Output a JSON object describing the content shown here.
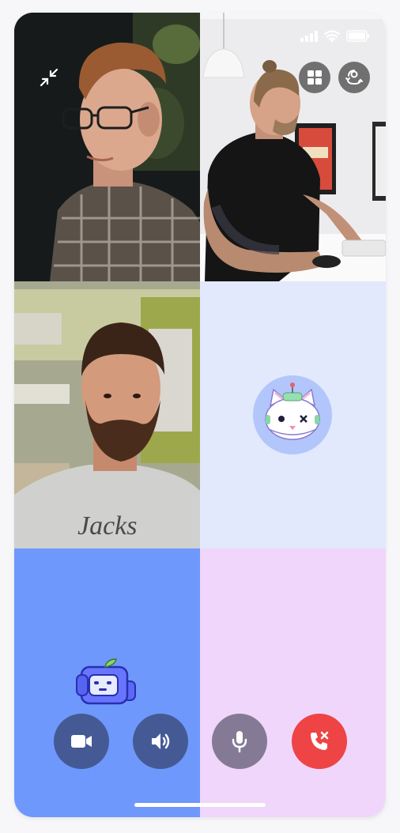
{
  "call": {
    "participants": [
      {
        "id": "p1",
        "type": "video",
        "bg": "#1a1d1f"
      },
      {
        "id": "p2",
        "type": "video",
        "bg": "#e9eaec"
      },
      {
        "id": "p3",
        "type": "video",
        "bg": "#9fa58d"
      },
      {
        "id": "p4",
        "type": "avatar",
        "avatar": "cat-robot-avatar",
        "bg": "#e2e9fd",
        "avatar_bg": "#b3c6fb"
      },
      {
        "id": "p5",
        "type": "avatar",
        "avatar": "robot-avatar",
        "bg": "#6e98fc"
      },
      {
        "id": "p6",
        "type": "empty",
        "bg": "#f0d6fb"
      }
    ],
    "top_actions": [
      "minimize-icon",
      "grid-layout-icon",
      "switch-camera-icon"
    ],
    "controls": [
      {
        "name": "camera-button",
        "icon": "video-camera-icon",
        "color": "#455a94"
      },
      {
        "name": "speaker-button",
        "icon": "speaker-icon",
        "color": "#455a94"
      },
      {
        "name": "microphone-button",
        "icon": "microphone-icon",
        "color": "#857a96"
      },
      {
        "name": "end-call-button",
        "icon": "end-call-icon",
        "color": "#ee4445"
      }
    ]
  },
  "status_bar": {
    "icons": [
      "signal-icon",
      "wifi-icon",
      "battery-icon"
    ]
  }
}
